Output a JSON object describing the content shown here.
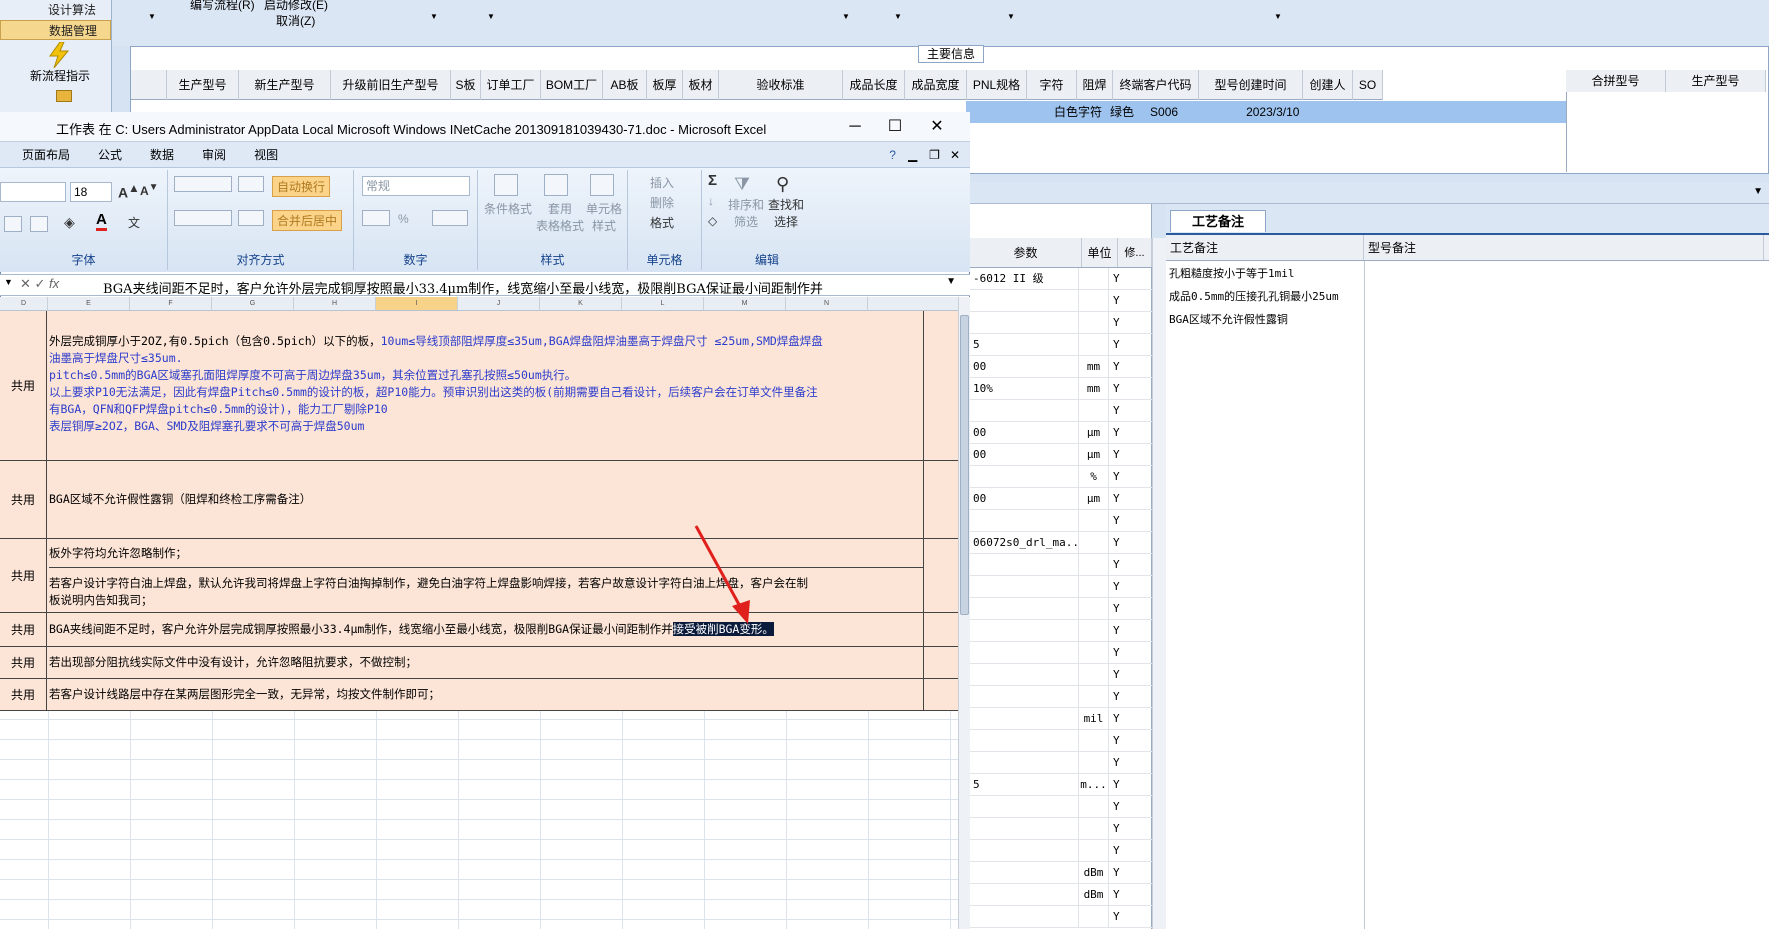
{
  "left_nav": {
    "items": [
      "设计算法",
      "数据管理"
    ],
    "new_flow": "新流程指示"
  },
  "toolbar": {
    "edit_flow": "编写流程(R)",
    "start_modify": "启动修改(E)",
    "cancel": "取消(Z)"
  },
  "main_info": {
    "title": "主要信息",
    "columns": [
      "生产型号",
      "新生产型号",
      "升级前旧生产型号",
      "S板",
      "订单工厂",
      "BOM工厂",
      "AB板",
      "板厚",
      "板材",
      "验收标准",
      "成品长度",
      "成品宽度",
      "PNL规格",
      "字符",
      "阻焊",
      "终端客户代码",
      "型号创建时间",
      "创建人",
      "SO"
    ],
    "row": {
      "char": "白色字符",
      "mask": "绿色",
      "customer": "S006",
      "created": "2023/3/10"
    },
    "right_columns": [
      "合拼型号",
      "生产型号"
    ]
  },
  "params": {
    "headers": [
      "参数",
      "单位",
      "修..."
    ],
    "rows": [
      [
        "-6012 II 级",
        "",
        "Y"
      ],
      [
        "",
        "",
        "Y"
      ],
      [
        "",
        "",
        "Y"
      ],
      [
        "5",
        "",
        "Y"
      ],
      [
        "00",
        "mm",
        "Y"
      ],
      [
        "10%",
        "mm",
        "Y"
      ],
      [
        "",
        "",
        "Y"
      ],
      [
        "00",
        "μm",
        "Y"
      ],
      [
        "00",
        "μm",
        "Y"
      ],
      [
        "",
        "%",
        "Y"
      ],
      [
        "00",
        "μm",
        "Y"
      ],
      [
        "",
        "",
        "Y"
      ],
      [
        "06072s0_drl_ma...",
        "",
        "Y"
      ],
      [
        "",
        "",
        "Y"
      ],
      [
        "",
        "",
        "Y"
      ],
      [
        "",
        "",
        "Y"
      ],
      [
        "",
        "",
        "Y"
      ],
      [
        "",
        "",
        "Y"
      ],
      [
        "",
        "",
        "Y"
      ],
      [
        "",
        "",
        "Y"
      ],
      [
        "",
        "mil",
        "Y"
      ],
      [
        "",
        "",
        "Y"
      ],
      [
        "",
        "",
        "Y"
      ],
      [
        "5",
        "m...",
        "Y"
      ],
      [
        "",
        "",
        "Y"
      ],
      [
        "",
        "",
        "Y"
      ],
      [
        "",
        "",
        "Y"
      ],
      [
        "",
        "dBm",
        "Y"
      ],
      [
        "",
        "dBm",
        "Y"
      ],
      [
        "",
        "",
        "Y"
      ]
    ]
  },
  "craft": {
    "tab": "工艺备注",
    "headers": [
      "工艺备注",
      "型号备注"
    ],
    "notes": [
      "孔粗糙度按小于等于1mil",
      "成品0.5mm的压接孔孔铜最小25um",
      "BGA区域不允许假性露铜"
    ]
  },
  "excel": {
    "title": "工作表 在 C: Users Administrator AppData Local Microsoft Windows INetCache 201309181039430-71.doc - Microsoft Excel",
    "menu": [
      "页面布局",
      "公式",
      "数据",
      "审阅",
      "视图"
    ],
    "ribbon": {
      "font_size": "18",
      "wrap": "自动换行",
      "merge": "合并后居中",
      "number_format": "常规",
      "cond_format": "条件格式",
      "table_format": "套用\n表格格式",
      "cell_style": "单元格\n样式",
      "insert": "插入",
      "delete": "删除",
      "format": "格式",
      "sort": "排序和\n筛选",
      "find": "查找和\n选择",
      "groups": [
        "字体",
        "对齐方式",
        "数字",
        "样式",
        "单元格",
        "编辑"
      ]
    },
    "formula": "BGA夹线间距不足时，客户允许外层完成铜厚按照最小33.4μm制作，线宽缩小至最小线宽，极限削BGA保证最小间距制作并",
    "columns": [
      "D",
      "E",
      "F",
      "G",
      "H",
      "I",
      "J",
      "K",
      "L",
      "M",
      "N"
    ],
    "rows": [
      {
        "label": "共用",
        "lines": [
          {
            "t": "外层完成铜厚小于2OZ,有0.5pich（包含0.5pich）以下的板，",
            "b": "10um≤导线顶部阻焊厚度≤35um,BGA焊盘阻焊油墨高于焊盘尺寸 ≤25um,SMD焊盘焊盘"
          },
          {
            "t": "",
            "b": "油墨高于焊盘尺寸≤35um."
          },
          {
            "t": "",
            "b": "pitch≤0.5mm的BGA区域塞孔面阻焊厚度不可高于周边焊盘35um，其余位置过孔塞孔按照≤50um执行。"
          },
          {
            "t": "",
            "b": "以上要求P10无法满足，因此有焊盘Pitch≤0.5mm的设计的板，超P10能力。预审识别出这类的板(前期需要自己看设计，后续客户会在订单文件里备注"
          },
          {
            "t": "",
            "b": "有BGA，QFN和QFP焊盘pitch≤0.5mm的设计)，能力工厂剔除P10"
          },
          {
            "t": "",
            "b": "表层铜厚≥2OZ，BGA、SMD及阻焊塞孔要求不可高于焊盘50um"
          }
        ]
      },
      {
        "label": "共用",
        "text": "BGA区域不允许假性露铜（阻焊和终检工序需备注）"
      },
      {
        "label": "共用",
        "text": "板外字符均允许忽略制作；",
        "text2": "若客户设计字符白油上焊盘，默认允许我司将焊盘上字符白油掏掉制作，避免白油字符上焊盘影响焊接，若客户故意设计字符白油上焊盘，客户会在制",
        "text3": "板说明内告知我司；"
      },
      {
        "label": "共用",
        "text": "BGA夹线间距不足时，客户允许外层完成铜厚按照最小33.4μm制作，线宽缩小至最小线宽，极限削BGA保证最小间距制作并",
        "sel": "接受被削BGA变形。"
      },
      {
        "label": "共用",
        "text": "若出现部分阻抗线实际文件中没有设计，允许忽略阻抗要求，不做控制；"
      },
      {
        "label": "共用",
        "text": "若客户设计线路层中存在某两层图形完全一致，无异常，均按文件制作即可；"
      }
    ]
  },
  "colors": {
    "row_fill": "#fce4d6",
    "blue_text": "#2b3ccc",
    "arrow": "#e0201c",
    "selection": "#0a1a3a"
  }
}
